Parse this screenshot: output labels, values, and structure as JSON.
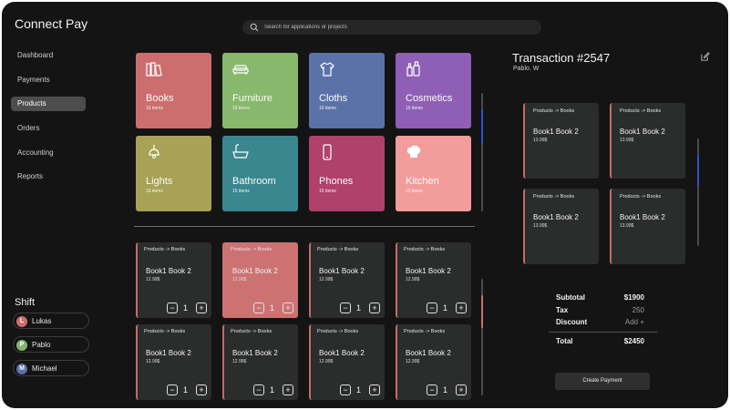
{
  "app": {
    "title": "Connect Pay"
  },
  "sidebar": {
    "items": [
      {
        "label": "Dashboard"
      },
      {
        "label": "Payments"
      },
      {
        "label": "Products",
        "active": true
      },
      {
        "label": "Orders"
      },
      {
        "label": "Accounting"
      },
      {
        "label": "Reports"
      }
    ]
  },
  "shift": {
    "title": "Shift",
    "people": [
      {
        "initial": "L",
        "name": "Lukas",
        "color": "#cd6e6e"
      },
      {
        "initial": "P",
        "name": "Pablo",
        "color": "#83b66b"
      },
      {
        "initial": "M",
        "name": "Michael",
        "color": "#5c6fa6"
      }
    ]
  },
  "search": {
    "placeholder": "Search for applications or projects",
    "icon": "search-icon"
  },
  "categories": [
    {
      "name": "Books",
      "count": "15 items",
      "color": "#cd6e6e",
      "icon": "books-icon"
    },
    {
      "name": "Furniture",
      "count": "15 items",
      "color": "#87b86b",
      "icon": "sofa-icon"
    },
    {
      "name": "Cloths",
      "count": "15 items",
      "color": "#5b72a8",
      "icon": "shirt-icon"
    },
    {
      "name": "Cosmetics",
      "count": "15 items",
      "color": "#8e5fb5",
      "icon": "cosmetics-icon"
    },
    {
      "name": "Lights",
      "count": "15 items",
      "color": "#a7a255",
      "icon": "lamp-icon"
    },
    {
      "name": "Bathroom",
      "count": "15 items",
      "color": "#3a8790",
      "icon": "bathtub-icon"
    },
    {
      "name": "Phones",
      "count": "15 items",
      "color": "#b0416b",
      "icon": "phone-icon"
    },
    {
      "name": "Kitchen",
      "count": "15 items",
      "color": "#f29c9c",
      "icon": "chef-hat-icon"
    }
  ],
  "products": [
    {
      "path": "Products -> Books",
      "title": "Book1 Book 2",
      "price": "12.99$",
      "qty": "1",
      "selected": false
    },
    {
      "path": "Products -> Books",
      "title": "Book1 Book 2",
      "price": "12.99$",
      "qty": "1",
      "selected": true
    },
    {
      "path": "Products -> Books",
      "title": "Book1 Book 2",
      "price": "12.99$",
      "qty": "1",
      "selected": false
    },
    {
      "path": "Products -> Books",
      "title": "Book1 Book 2",
      "price": "12.99$",
      "qty": "1",
      "selected": false
    },
    {
      "path": "Products -> Books",
      "title": "Book1 Book 2",
      "price": "12.99$",
      "qty": "1",
      "selected": false
    },
    {
      "path": "Products -> Books",
      "title": "Book1 Book 2",
      "price": "12.99$",
      "qty": "1",
      "selected": false
    },
    {
      "path": "Products -> Books",
      "title": "Book1 Book 2",
      "price": "12.99$",
      "qty": "1",
      "selected": false
    },
    {
      "path": "Products -> Books",
      "title": "Book1 Book 2",
      "price": "12.99$",
      "qty": "1",
      "selected": false
    }
  ],
  "transaction": {
    "title": "Transaction #2547",
    "customer": "Pablo. W",
    "items": [
      {
        "path": "Products -> Books",
        "title": "Book1 Book 2",
        "price": "13.99$"
      },
      {
        "path": "Products -> Books",
        "title": "Book1 Book 2",
        "price": "13.99$"
      },
      {
        "path": "Products -> Books",
        "title": "Book1 Book 2",
        "price": "13.99$"
      },
      {
        "path": "Products -> Books",
        "title": "Book1 Book 2",
        "price": "13.99$"
      }
    ],
    "subtotal_label": "Subtotal",
    "subtotal": "$1900",
    "tax_label": "Tax",
    "tax": "250",
    "discount_label": "Discount",
    "discount": "Add +",
    "total_label": "Total",
    "total": "$2450",
    "pay_button": "Create Payment"
  },
  "colors": {
    "accent": "#cd6e6e",
    "scroll_thumb_main": "#2b57c8",
    "scroll_thumb_products": "#cd6e6e"
  }
}
